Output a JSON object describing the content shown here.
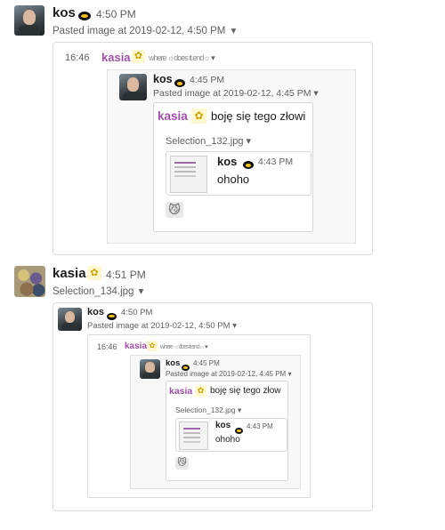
{
  "post1": {
    "author": "kos",
    "time": "4:50 PM",
    "attachment_title": "Pasted image at 2019-02-12, 4:50 PM",
    "quote": {
      "time": "16:46",
      "author": "kasia",
      "text": "where ",
      "text2": "does it end",
      "inner": {
        "author": "kos",
        "time": "4:45 PM",
        "attachment_title": "Pasted image at 2019-02-12, 4:45 PM",
        "kasia_name": "kasia",
        "kasia_text": "boję się tego złowi",
        "file": "Selection_132.jpg",
        "nested": {
          "author": "kos",
          "time": "4:43 PM",
          "text": "ohoho"
        }
      }
    }
  },
  "post2": {
    "author": "kasia",
    "time": "4:51 PM",
    "file": "Selection_134.jpg",
    "shot": {
      "author": "kos",
      "time": "4:50 PM",
      "attachment_title": "Pasted image at 2019-02-12, 4:50 PM",
      "quote": {
        "time": "16:46",
        "author": "kasia",
        "text": "where ",
        "text2": "does it end",
        "inner": {
          "author": "kos",
          "time": "4:45 PM",
          "attachment_title": "Pasted image at 2019-02-12, 4:45 PM",
          "kasia_name": "kasia",
          "kasia_text": "boję się tego złow",
          "file": "Selection_132.jpg",
          "nested": {
            "author": "kos",
            "time": "4:43 PM",
            "text": "ohoho"
          }
        }
      }
    }
  },
  "icons": {
    "caret": "▾",
    "squiggle": "☼"
  }
}
